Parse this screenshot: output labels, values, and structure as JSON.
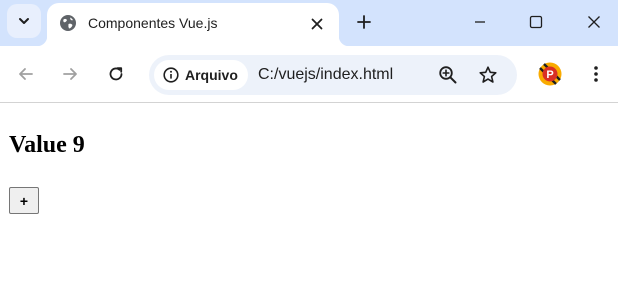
{
  "browser": {
    "tab": {
      "title": "Componentes Vue.js",
      "favicon": "globe-icon"
    },
    "toolbar": {
      "site_chip_label": "Arquivo",
      "url": "C:/vuejs/index.html",
      "icons": {
        "back": "arrow-left-icon",
        "forward": "arrow-right-icon",
        "reload": "reload-icon",
        "info": "info-icon",
        "zoom": "zoom-in-icon",
        "bookmark": "star-icon",
        "extension": "extension-icon",
        "menu": "kebab-menu-icon"
      }
    },
    "window_controls": [
      "minimize-icon",
      "maximize-icon",
      "close-icon"
    ]
  },
  "page": {
    "heading": "Value 9",
    "increment_button_label": "+"
  },
  "colors": {
    "tabstrip_bg": "#d3e3fd",
    "omnibox_bg": "#edf2fa",
    "extension_red": "#d93025",
    "extension_yellow": "#f9ab00"
  }
}
